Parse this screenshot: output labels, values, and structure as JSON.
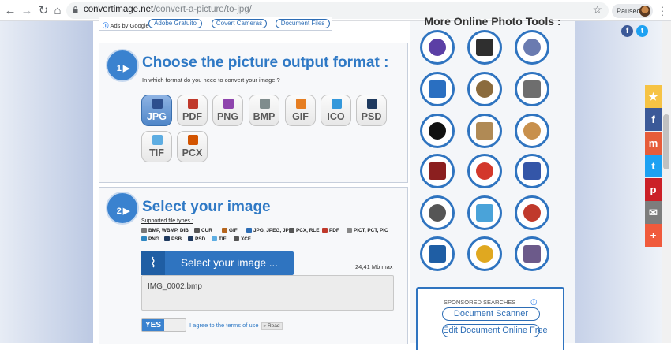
{
  "browser": {
    "url_domain": "convertimage.net",
    "url_path": "/convert-a-picture/to-jpg/",
    "profile_label": "Paused",
    "icons": [
      "back-icon",
      "forward-icon",
      "reload-icon",
      "home-icon",
      "lock-icon",
      "bookmark-star-icon",
      "menu-icon"
    ]
  },
  "ads": {
    "label": "Ads by Google",
    "links": [
      "Adobe Gratuito",
      "Covert Cameras",
      "Document Files"
    ]
  },
  "section1": {
    "number": "1",
    "title": "Choose the picture output format :",
    "subtitle": "In which format do you need to convert your image ?",
    "formats": [
      {
        "label": "JPG",
        "selected": true,
        "color": "#2d4f8e"
      },
      {
        "label": "PDF",
        "selected": false,
        "color": "#c0392b"
      },
      {
        "label": "PNG",
        "selected": false,
        "color": "#8e44ad"
      },
      {
        "label": "BMP",
        "selected": false,
        "color": "#7f8c8d"
      },
      {
        "label": "GIF",
        "selected": false,
        "color": "#e67e22"
      },
      {
        "label": "ICO",
        "selected": false,
        "color": "#3498db"
      },
      {
        "label": "PSD",
        "selected": false,
        "color": "#1f3a5f"
      },
      {
        "label": "TIF",
        "selected": false,
        "color": "#5dade2"
      },
      {
        "label": "PCX",
        "selected": false,
        "color": "#d35400"
      }
    ]
  },
  "section2": {
    "number": "2",
    "title": "Select your image",
    "supported_title": "Supported file types :",
    "file_types_row1": [
      "BMP, WBMP, DIB",
      "CUR",
      "GIF",
      "JPG, JPEG, JPE",
      "PCX, RLE",
      "PDF",
      "PICT, PCT, PIC"
    ],
    "file_types_row2": [
      "PNG",
      "PSB",
      "PSD",
      "TIF",
      "XCF"
    ],
    "select_button": "Select your image ...",
    "max_size": "24,41 Mb max",
    "file_name": "IMG_0002.bmp",
    "toggle_label": "YES",
    "agree_text": "I agree to the terms of use",
    "read_label": "» Read"
  },
  "sidebar": {
    "title": "More Online Photo Tools :",
    "tools": [
      "rotate-icon",
      "crop-icon",
      "perspective-icon",
      "blue-arrow-icon",
      "filmstrip-icon",
      "stamp-icon",
      "black-white-icon",
      "sepia-photo-icon",
      "palette-icon",
      "tv-icon",
      "pop-art-icon",
      "sphere-icon",
      "child-photo-icon",
      "3d-glasses-icon",
      "text-logo-icon",
      "coin-icon",
      "golden-cube-icon",
      "photo-mosaic-icon"
    ],
    "sponsored_label": "SPONSORED SEARCHES",
    "sponsored_links": [
      "Document Scanner",
      "Edit Document Online Free"
    ]
  },
  "social": {
    "top": [
      {
        "label": "f",
        "color": "#3b5998"
      },
      {
        "label": "t",
        "color": "#1da1f2"
      }
    ],
    "share": [
      {
        "label": "★",
        "color": "#f6c344"
      },
      {
        "label": "f",
        "color": "#3b5998"
      },
      {
        "label": "m",
        "color": "#e65c3a"
      },
      {
        "label": "t",
        "color": "#1da1f2"
      },
      {
        "label": "p",
        "color": "#cb2027"
      },
      {
        "label": "✉",
        "color": "#7d7d7d"
      },
      {
        "label": "+",
        "color": "#f05a3c"
      }
    ]
  }
}
